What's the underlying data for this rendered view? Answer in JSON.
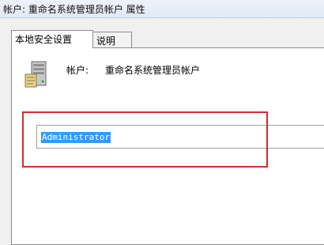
{
  "window": {
    "title": "帐户: 重命名系统管理员帐户 属性"
  },
  "tabs": [
    {
      "label": "本地安全设置",
      "active": true
    },
    {
      "label": "说明",
      "active": false
    }
  ],
  "policy": {
    "label": "帐户:",
    "name": "重命名系统管理员帐户",
    "icon": "server-icon"
  },
  "input": {
    "value": "Administrator",
    "selected": true
  },
  "colors": {
    "highlight_border": "#d32d2d",
    "selection": "#3399ff"
  }
}
